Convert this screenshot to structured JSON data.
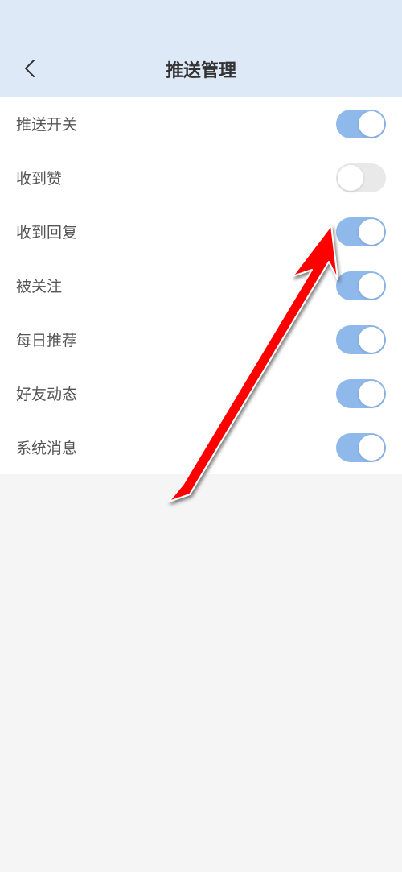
{
  "header": {
    "title": "推送管理"
  },
  "settings": [
    {
      "id": "push-master",
      "label": "推送开关",
      "on": true
    },
    {
      "id": "received-like",
      "label": "收到赞",
      "on": false
    },
    {
      "id": "received-reply",
      "label": "收到回复",
      "on": true
    },
    {
      "id": "followed",
      "label": "被关注",
      "on": true
    },
    {
      "id": "daily-recommend",
      "label": "每日推荐",
      "on": true
    },
    {
      "id": "friend-activity",
      "label": "好友动态",
      "on": true
    },
    {
      "id": "system-message",
      "label": "系统消息",
      "on": true
    }
  ],
  "colors": {
    "headerBg": "#dee9f7",
    "toggleOn": "#8fb8eb",
    "toggleOff": "#e9e9e9",
    "arrow": "#ff0000"
  }
}
